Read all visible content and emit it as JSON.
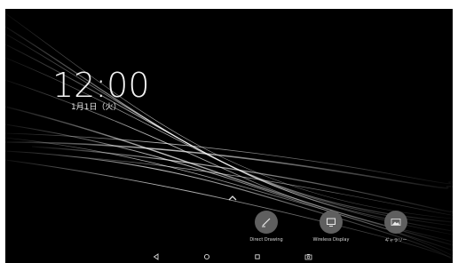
{
  "lockscreen": {
    "time": "12:00",
    "date": "1月1日（火）"
  },
  "shortcuts": [
    {
      "label": "Direct Drawing",
      "icon": "pen-edit-icon"
    },
    {
      "label": "Wireless Display",
      "icon": "monitor-icon"
    },
    {
      "label": "ギャラリー",
      "icon": "image-icon"
    }
  ],
  "navbar": {
    "buttons": [
      "back-icon",
      "home-icon",
      "recents-icon",
      "screenshot-icon"
    ]
  },
  "colors": {
    "background": "#000000",
    "shortcut_circle": "#5f5f5f",
    "text": "#f2f2f2"
  }
}
